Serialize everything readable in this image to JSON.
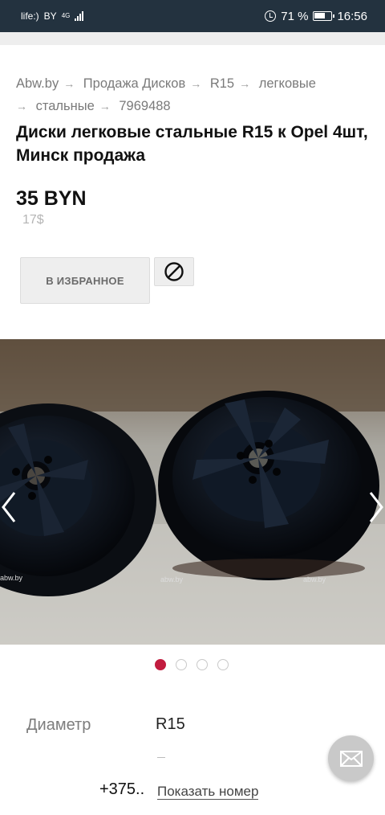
{
  "status_bar": {
    "carrier": "life:)",
    "network_region": "BY",
    "network_type": "4G",
    "battery": "71 %",
    "time": "16:56"
  },
  "breadcrumb": {
    "items": [
      "Abw.by",
      "Продажа Дисков",
      "R15",
      "легковые",
      "стальные",
      "7969488"
    ],
    "separator": "→"
  },
  "listing": {
    "title": "Диски легковые стальные R15 к Opel 4шт, Минск продажа",
    "price": "35 BYN",
    "price_usd": "17$"
  },
  "actions": {
    "favorite_label": "В ИЗБРАННОЕ",
    "block_icon": "block-icon"
  },
  "gallery": {
    "watermark": "abw.by",
    "total_photos": 4,
    "current_photo": 1,
    "prev_icon": "chevron-left-icon",
    "next_icon": "chevron-right-icon"
  },
  "specs": [
    {
      "label": "Диаметр",
      "value": "R15"
    }
  ],
  "contact": {
    "phone_prefix": "+375..",
    "show_number_label": "Показать номер",
    "mail_icon": "mail-icon"
  },
  "colors": {
    "status_bar_bg": "#23323f",
    "accent": "#c21c3f",
    "button_bg": "#eeeeee"
  }
}
